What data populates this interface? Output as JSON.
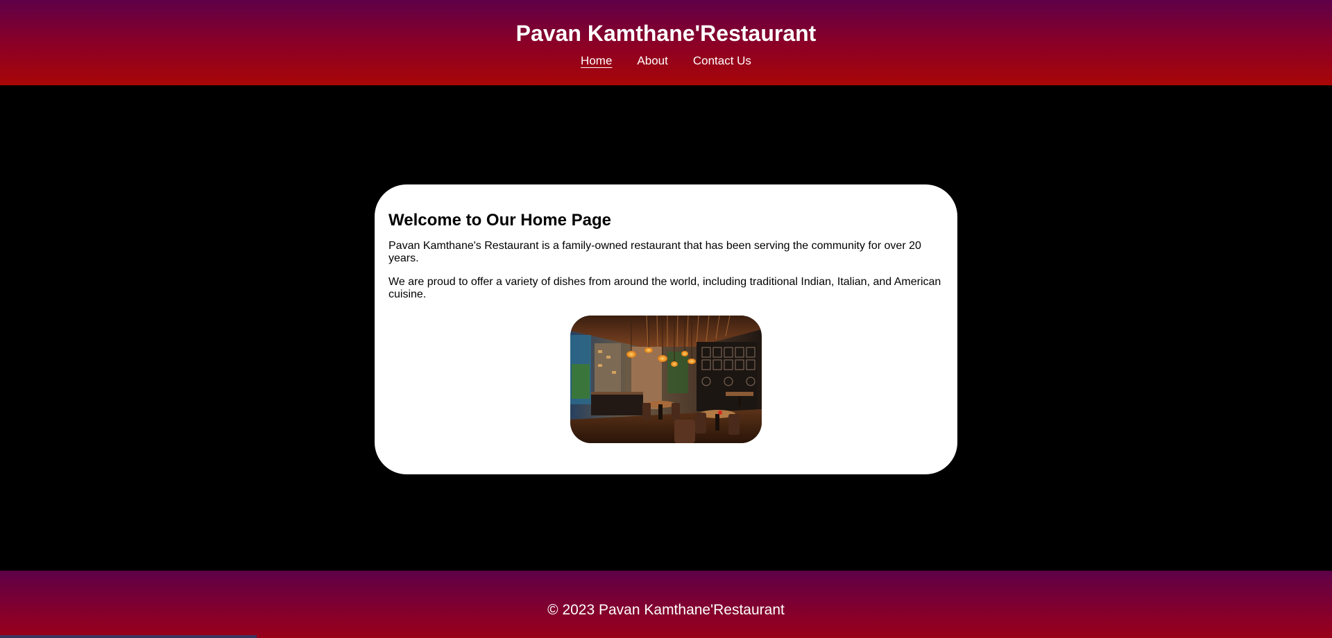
{
  "header": {
    "title": "Pavan Kamthane'Restaurant",
    "nav": [
      {
        "label": "Home",
        "active": true
      },
      {
        "label": "About",
        "active": false
      },
      {
        "label": "Contact Us",
        "active": false
      }
    ]
  },
  "main": {
    "heading": "Welcome to Our Home Page",
    "paragraphs": [
      "Pavan Kamthane's Restaurant is a family-owned restaurant that has been serving the community for over 20 years.",
      "We are proud to offer a variety of dishes from around the world, including traditional Indian, Italian, and American cuisine."
    ],
    "image": {
      "subject": "restaurant interior photo"
    }
  },
  "footer": {
    "copyright": "© 2023 Pavan Kamthane'Restaurant"
  },
  "colors": {
    "page_background": "#000000",
    "header_gradient_top": "#5e0048",
    "header_gradient_bottom": "#a80606",
    "card_background": "#ffffff",
    "text_light": "#ffffff"
  }
}
